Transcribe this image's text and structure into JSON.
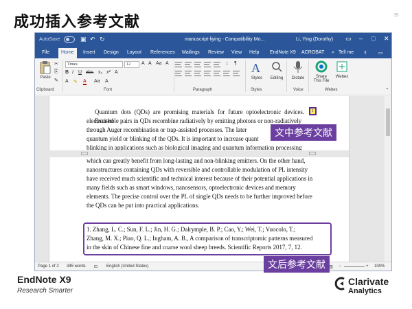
{
  "slide": {
    "title": "成功插入参考文献",
    "page_number": "75"
  },
  "window": {
    "autosave": "AutoSave",
    "doc_title": "manuscript-liying  -  Compatibility Mo...",
    "user": "Li, Ying (Dorothy)"
  },
  "tabs": [
    "File",
    "Home",
    "Insert",
    "Design",
    "Layout",
    "References",
    "Mailings",
    "Review",
    "View",
    "Help",
    "EndNote X9",
    "ACROBAT",
    "Tell me"
  ],
  "ribbon": {
    "paste": "Paste",
    "font_name": "Times",
    "font_size": "12",
    "styles": "Styles",
    "editing": "Editing",
    "dictate": "Dictate",
    "share_line1": "Share",
    "share_line2": "This File",
    "webex": "Webex",
    "groups": {
      "clipboard": "Clipboard",
      "font": "Font",
      "paragraph": "Paragraph",
      "styles": "Styles",
      "voice": "Voice",
      "webex": "Webex"
    }
  },
  "document": {
    "para1": [
      "Quantum dots (QDs) are promising materials for future optoelectronic devices. Excited",
      "electron-hole pairs in QDs recombine radiatively by emitting photons or non-radiatively",
      "through Auger recombination or trap-assisted processes. The later",
      "quantum yield or blinking of the QDs. It is important to increase quant",
      "blinking in applications such as biological imaging and quantum information processing"
    ],
    "citation_mark": "1",
    "para2": [
      "which can greatly benefit from long-lasting and non-blinking emitters. On the other hand,",
      "nanostructures containing QDs with reversible and controllable modulation of PL intensity",
      "have received much scientific and technical interest because of their potential applications in",
      "many fields such as smart windows, nanosensors, optoelectronic devices and memory",
      "elements. The precise control over the PL of single QDs needs to be further improved before",
      "the QDs can be put into practical applications."
    ],
    "reference": [
      "1.      Zhang, L. C.;  Sun, F. L.;  Jin, H. G.;  Dalrymple, B. P.;  Cao, Y.;  Wei, T.;  Vuocolo, T.;",
      "Zhang, M. X.;  Piao, Q. L.;  Ingham, A. B., A comparison of transcriptomic patterns measured",
      "in the skin of Chinese fine and coarse wool sheep breeds. Scientific Reports 2017, 7, 12."
    ]
  },
  "callouts": {
    "in_text": "文中参考文献",
    "bibliography": "文后参考文献"
  },
  "statusbar": {
    "page": "Page 1 of 2",
    "words": "345 words",
    "language": "English (United States)",
    "zoom": "100%"
  },
  "footer": {
    "brand": "EndNote X9",
    "tagline": "Research Smarter",
    "company": "Clarivate",
    "company_sub": "Analytics"
  },
  "colors": {
    "word_blue": "#2b579a",
    "callout_purple": "#6b3fa0"
  }
}
